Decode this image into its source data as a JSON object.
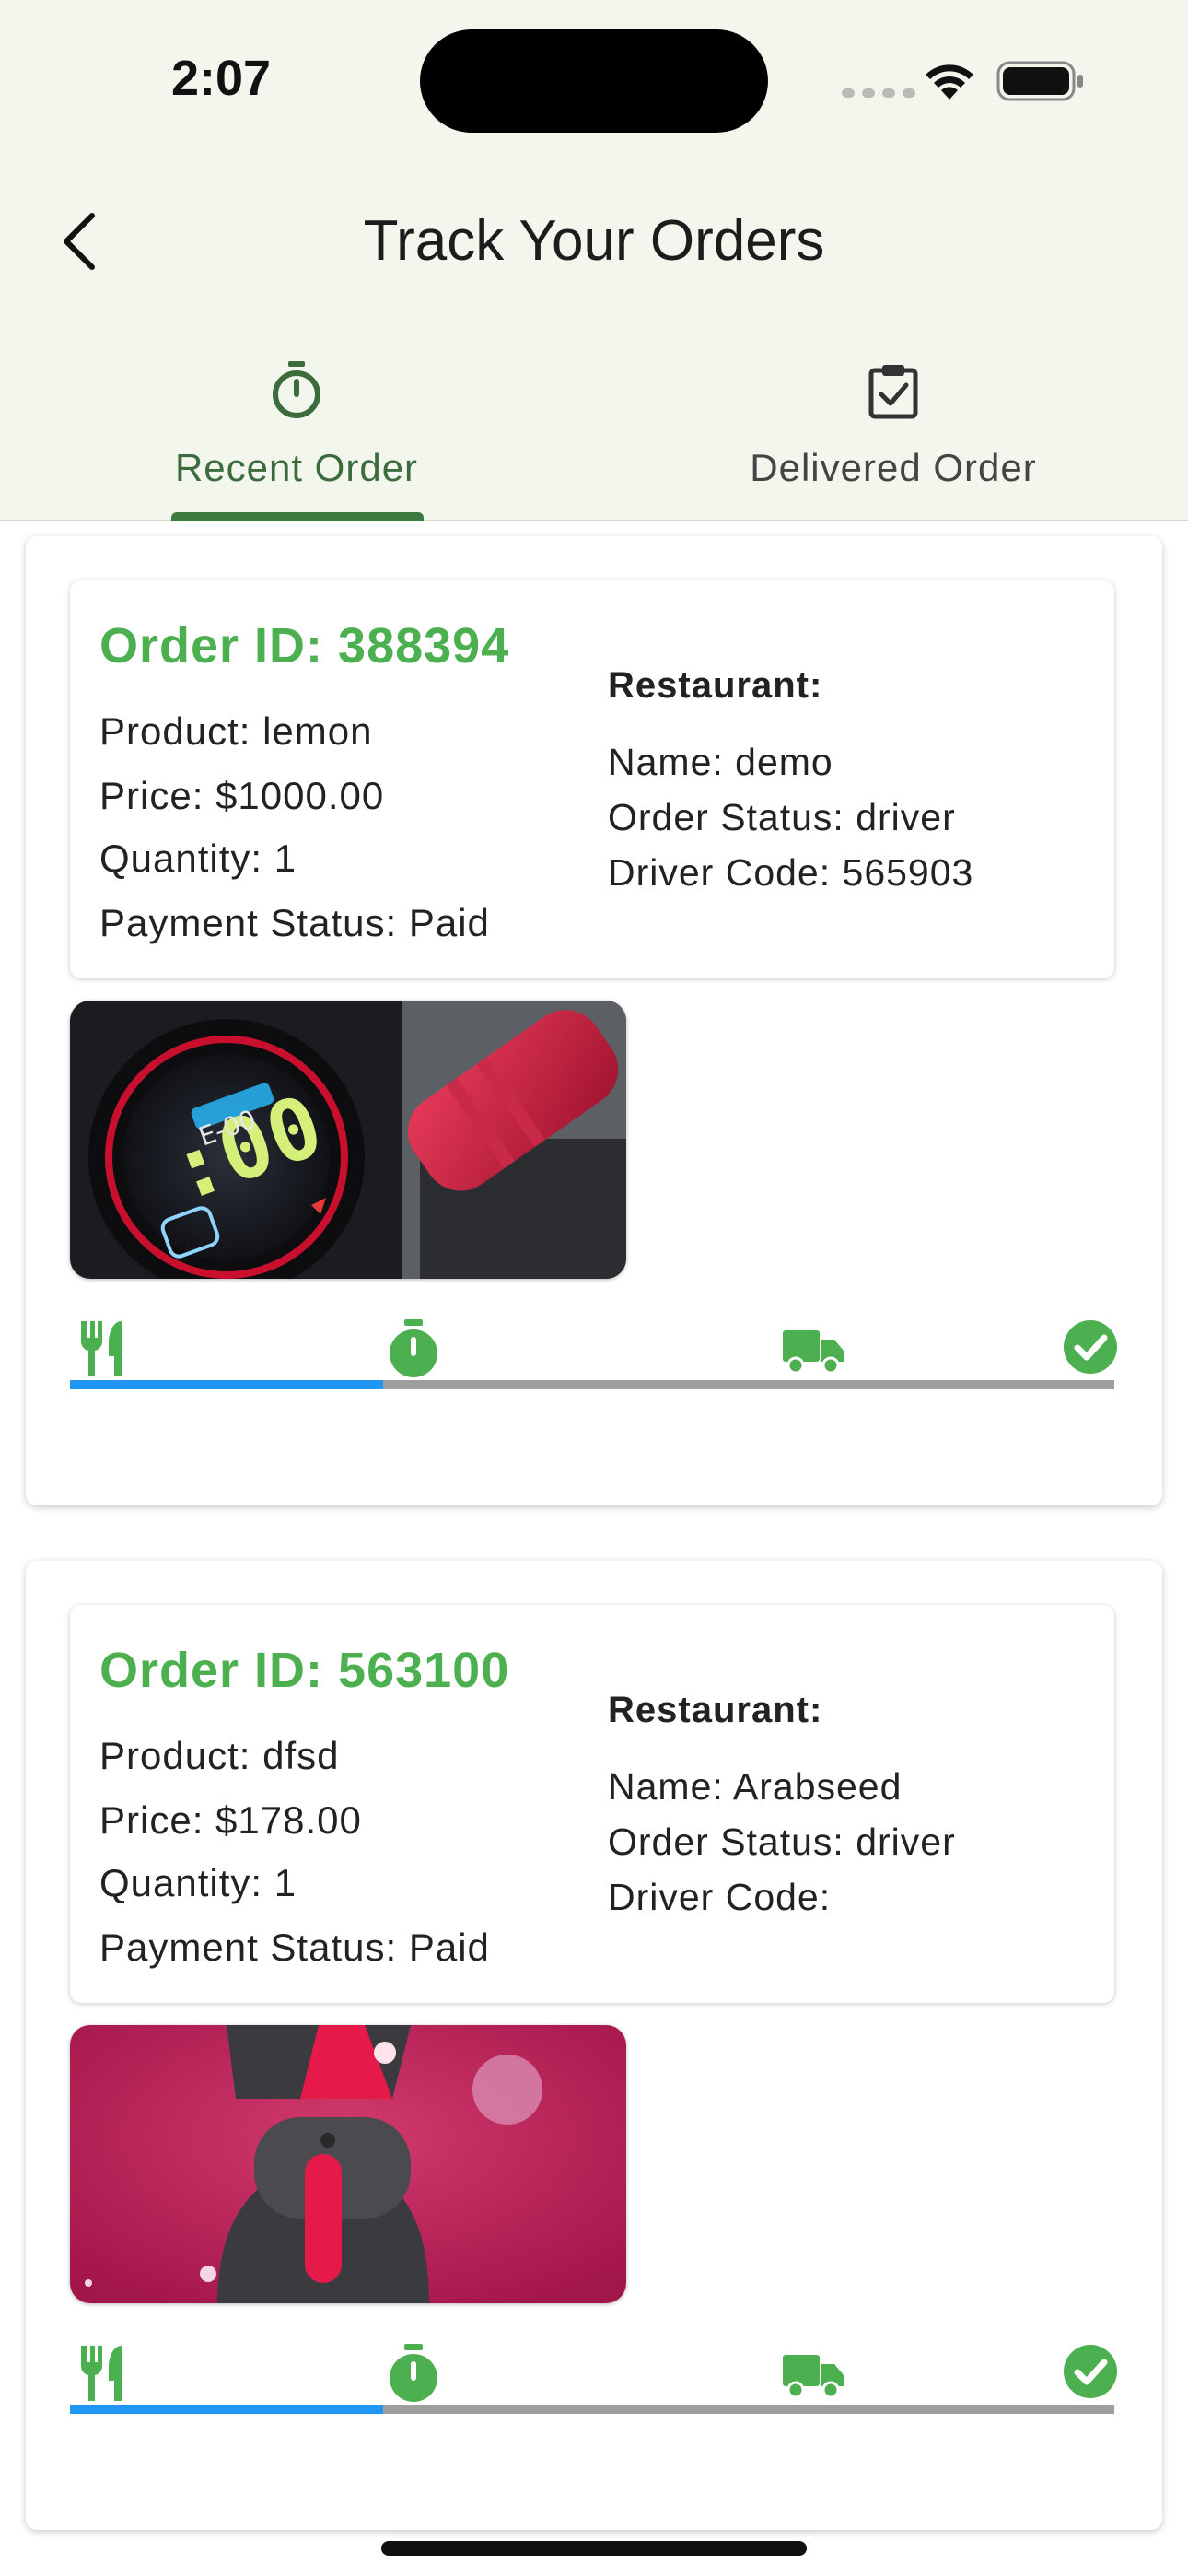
{
  "status_bar": {
    "time": "2:07"
  },
  "header": {
    "title": "Track Your Orders"
  },
  "tabs": [
    {
      "label": "Recent Order",
      "active": true
    },
    {
      "label": "Delivered Order",
      "active": false
    }
  ],
  "colors": {
    "accent": "#4caf50",
    "progress": "#2196f3",
    "track": "#9e9e9e",
    "header_bg": "#f2f6ec"
  },
  "orders": [
    {
      "order_id": "Order ID: 388394",
      "product": "Product: lemon",
      "price": "Price: $1000.00",
      "quantity": "Quantity: 1",
      "payment_status": "Payment Status: Paid",
      "restaurant_title": "Restaurant:",
      "restaurant_name": "Name: demo",
      "order_status": "Order Status: driver",
      "driver_code": "Driver Code: 565903",
      "progress_fraction": 0.3,
      "steps": [
        "restaurant-icon",
        "timer-icon",
        "truck-icon",
        "check-circle-icon"
      ]
    },
    {
      "order_id": "Order ID: 563100",
      "product": "Product: dfsd",
      "price": "Price: $178.00",
      "quantity": "Quantity: 1",
      "payment_status": "Payment Status: Paid",
      "restaurant_title": "Restaurant:",
      "restaurant_name": "Name: Arabseed",
      "order_status": "Order Status: driver",
      "driver_code": "Driver Code:",
      "progress_fraction": 0.3,
      "steps": [
        "restaurant-icon",
        "timer-icon",
        "truck-icon",
        "check-circle-icon"
      ]
    }
  ]
}
